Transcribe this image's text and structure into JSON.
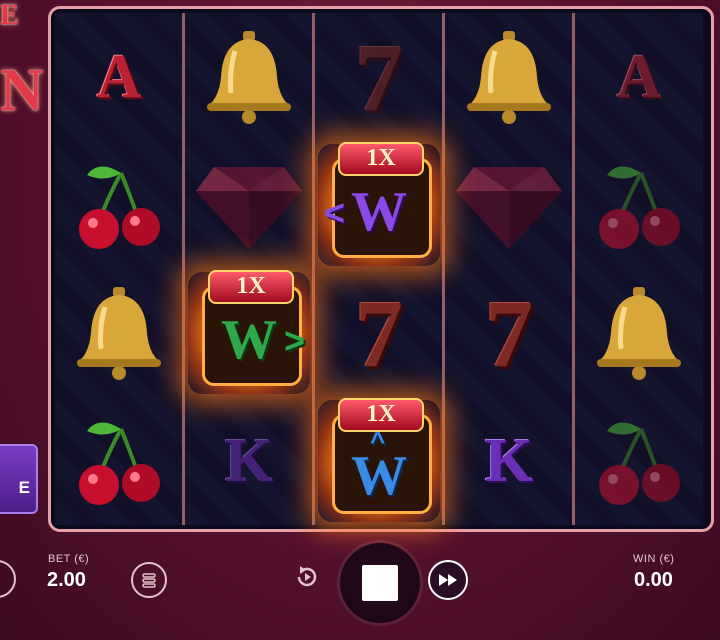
{
  "logo": {
    "letters": [
      "E",
      "N"
    ]
  },
  "feature_button": {
    "label": "E"
  },
  "reels": [
    [
      "A",
      "cherry",
      "bell",
      "cherry"
    ],
    [
      "bell",
      "diamond",
      "wild",
      "K"
    ],
    [
      "7",
      "wild",
      "7",
      "wild"
    ],
    [
      "bell",
      "diamond",
      "7",
      "K"
    ],
    [
      "A",
      "cherry",
      "bell",
      "cherry"
    ]
  ],
  "wilds": [
    {
      "multiplier": "1X",
      "letter": "W",
      "arrow": "<",
      "color": "#8a4ae6"
    },
    {
      "multiplier": "1X",
      "letter": "W",
      "arrow": ">",
      "color": "#2ea84a"
    },
    {
      "multiplier": "1X",
      "letter": "W",
      "arrow": "^",
      "color": "#3a8ae6"
    }
  ],
  "symbols": {
    "seven": "7",
    "ace": "A",
    "king": "K"
  },
  "hud": {
    "bet_label": "BET (€)",
    "bet_value": "2.00",
    "win_label": "WIN (€)",
    "win_value": "0.00"
  },
  "colors": {
    "background": "#5a1230",
    "frame_border": "#e8a0a8",
    "reel_bg": "#0f0d26",
    "glow": "#ff8a1e"
  }
}
